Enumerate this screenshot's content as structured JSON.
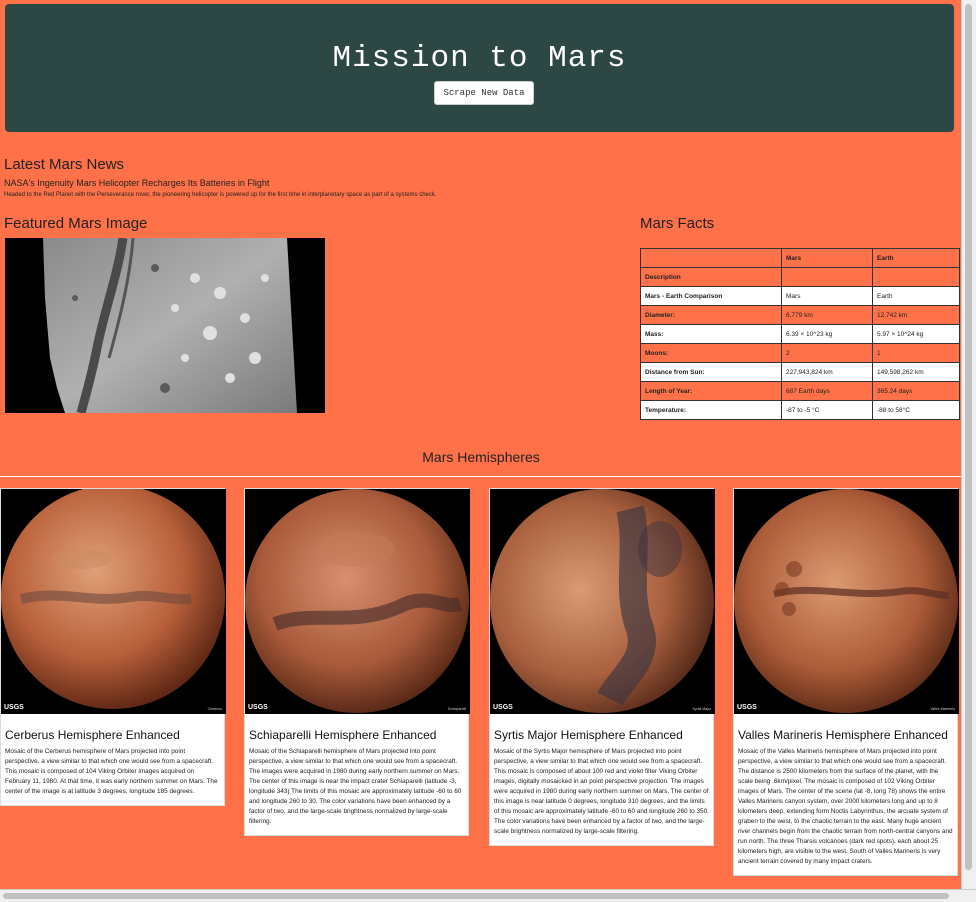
{
  "header": {
    "title": "Mission to Mars",
    "scrape_button": "Scrape New Data"
  },
  "news": {
    "heading": "Latest Mars News",
    "title": "NASA's Ingenuity Mars Helicopter Recharges Its Batteries in Flight",
    "teaser": "Headed to the Red Planet with the Perseverance rover, the pioneering helicopter is powered up for the first time in interplanetary space as part of a systems check."
  },
  "featured": {
    "heading": "Featured Mars Image"
  },
  "facts": {
    "heading": "Mars Facts",
    "columns": [
      "",
      "Mars",
      "Earth"
    ],
    "rows": [
      [
        "Description",
        "",
        ""
      ],
      [
        "Mars - Earth Comparison",
        "Mars",
        "Earth"
      ],
      [
        "Diameter:",
        "6,779 km",
        "12,742 km"
      ],
      [
        "Mass:",
        "6.39 × 10^23 kg",
        "5.97 × 10^24 kg"
      ],
      [
        "Moons:",
        "2",
        "1"
      ],
      [
        "Distance from Sun:",
        "227,943,824 km",
        "149,598,262 km"
      ],
      [
        "Length of Year:",
        "687 Earth days",
        "365.24 days"
      ],
      [
        "Temperature:",
        "-87 to -5 °C",
        "-88 to 58°C"
      ]
    ]
  },
  "hemispheres": {
    "heading": "Mars Hemispheres",
    "usgs": "USGS",
    "items": [
      {
        "title": "Cerberus Hemisphere Enhanced",
        "caption": "Cerberus",
        "description": "Mosaic of the Cerberus hemisphere of Mars projected into point perspective, a view similar to that which one would see from a spacecraft. This mosaic is composed of 104 Viking Orbiter images acquired on February 11, 1980. At that time, it was early northern summer on Mars. The center of the image is at latitude 3 degrees, longitude 185 degrees."
      },
      {
        "title": "Schiaparelli Hemisphere Enhanced",
        "caption": "Schiaparelli",
        "description": "Mosaic of the Schiaparelli hemisphere of Mars projected into point perspective, a view similar to that which one would see from a spacecraft. The images were acquired in 1980 during early northern summer on Mars. The center of this image is near the impact crater Schiaparelli (latitude -3, longitude 343) The limits of this mosaic are approximately latitude -60 to 60 and longitude 260 to 30. The color variations have been enhanced by a factor of two, and the large-scale brightness normalized by large-scale filtering."
      },
      {
        "title": "Syrtis Major Hemisphere Enhanced",
        "caption": "Syrtis Major",
        "description": "Mosaic of the Syrtis Major hemisphere of Mars projected into point perspective, a view similar to that which one would see from a spacecraft. This mosaic is composed of about 100 red and violet filter Viking Orbiter images, digitally mosaicked in an point perspective projection. The images were acquired in 1980 during early northern summer on Mars. The center of this image is near latitude 0 degrees, longitude 310 degrees, and the limits of this mosaic are approximately latitude -60 to 60 and longitude 260 to 350. The color variations have been enhanced by a factor of two, and the large-scale brightness normalized by large-scale filtering."
      },
      {
        "title": "Valles Marineris Hemisphere Enhanced",
        "caption": "Valles Marineris",
        "description": "Mosaic of the Valles Marineris hemisphere of Mars projected into point perspective, a view similar to that which one would see from a spacecraft. The distance is 2500 kilometers from the surface of the planet, with the scale being .6km/pixel. The mosaic is composed of 102 Viking Orbiter images of Mars. The center of the scene (lat -8, long 78) shows the entire Valles Marineris canyon system, over 2000 kilometers long and up to 8 kilometers deep, extending form Noctis Labyrinthus, the arcuate system of graben to the west, to the chaotic terrain to the east. Many huge ancient river channels begin from the chaotic terrain from north-central canyons and run north. The three Tharsis volcanoes (dark red spots), each about 25 kilometers high, are visible to the west. South of Valles Marineris is very ancient terrain covered by many impact craters."
      }
    ]
  }
}
